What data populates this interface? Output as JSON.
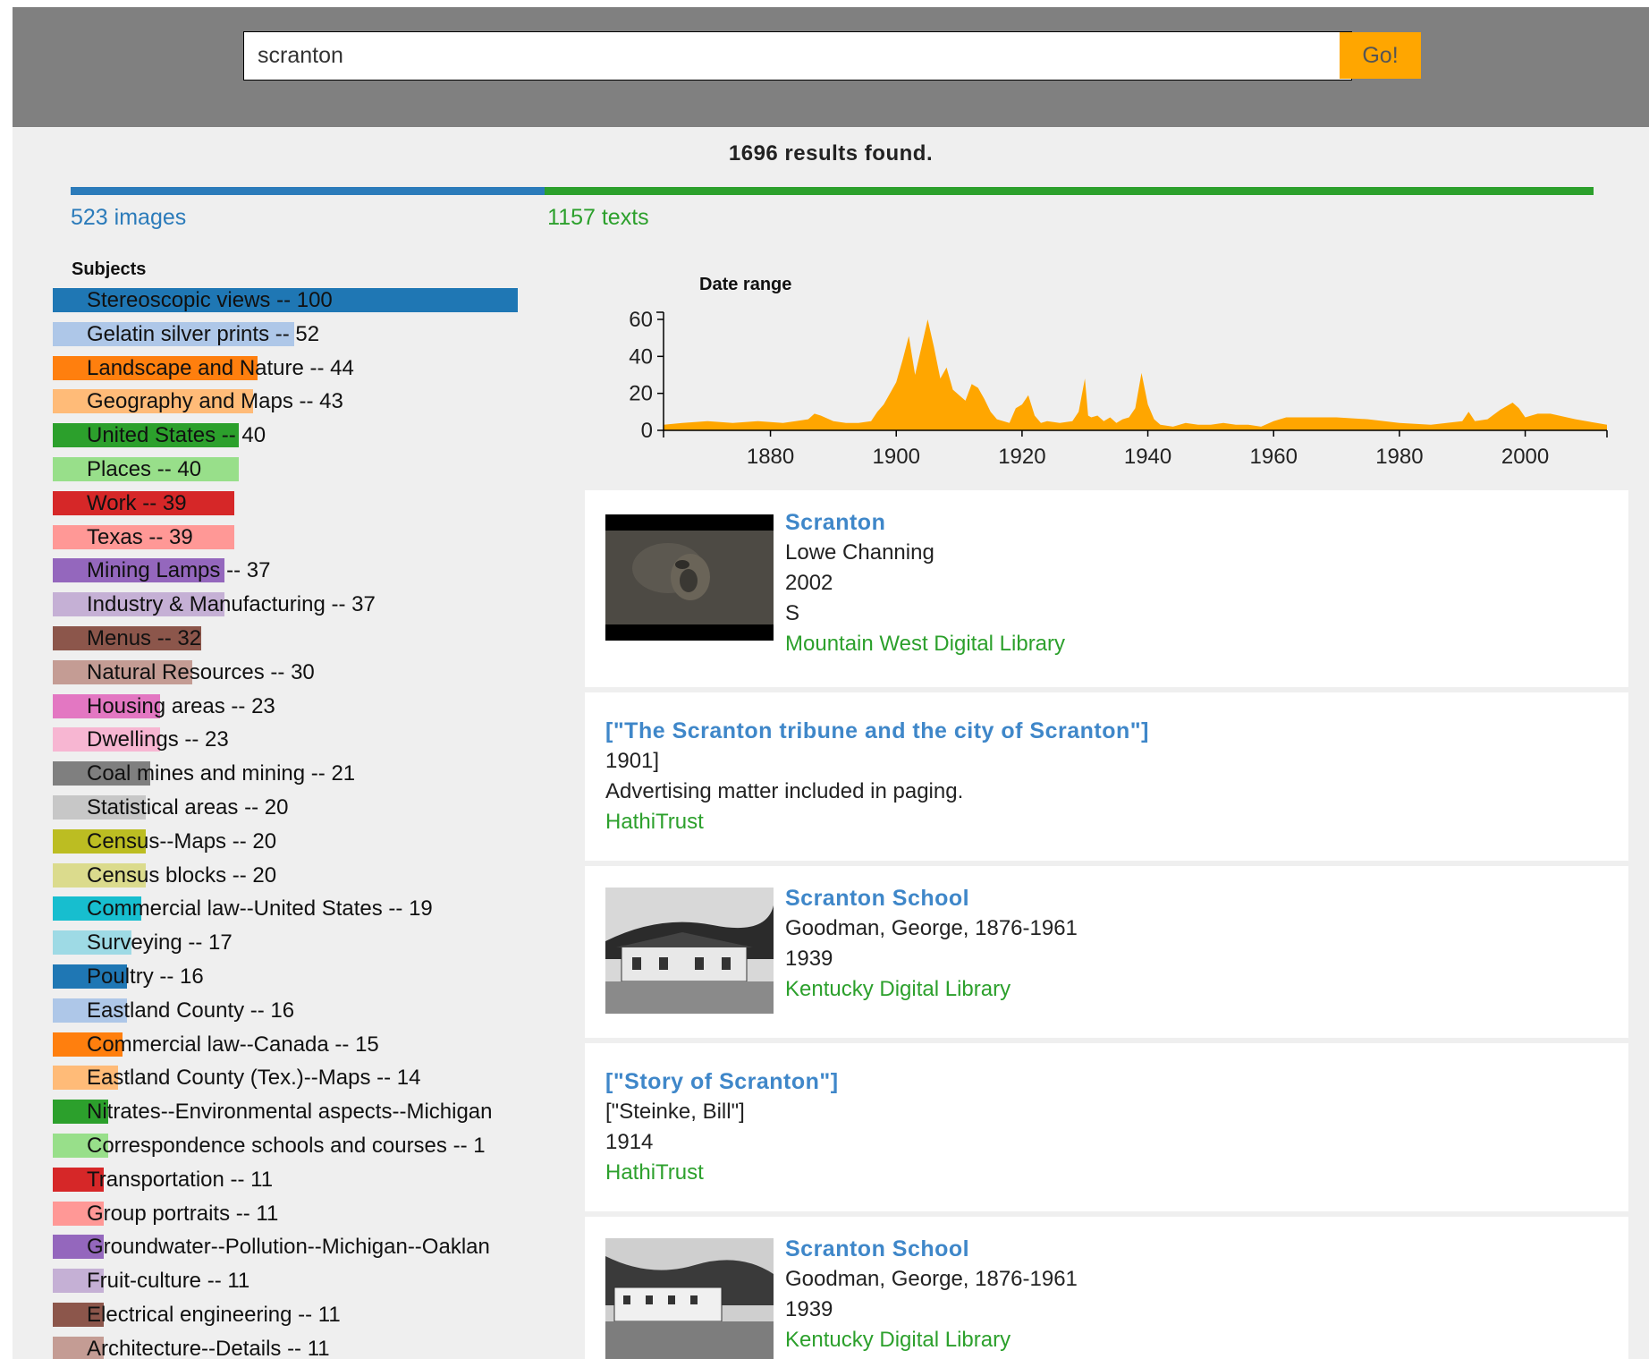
{
  "search": {
    "value": "scranton",
    "button_label": "Go!"
  },
  "summary": {
    "results_text": "1696 results found.",
    "images": {
      "count": 523,
      "label": "523 images",
      "color": "#2b7bba"
    },
    "texts": {
      "count": 1157,
      "label": "1157 texts",
      "color": "#2ca02c"
    }
  },
  "subjects": {
    "heading": "Subjects",
    "items": [
      {
        "label": "Stereoscopic views -- 100",
        "count": 100,
        "color": "#1f77b4"
      },
      {
        "label": "Gelatin silver prints -- 52",
        "count": 52,
        "color": "#aec7e8"
      },
      {
        "label": "Landscape and Nature -- 44",
        "count": 44,
        "color": "#ff7f0e"
      },
      {
        "label": "Geography and Maps -- 43",
        "count": 43,
        "color": "#ffbb78"
      },
      {
        "label": "United States -- 40",
        "count": 40,
        "color": "#2ca02c"
      },
      {
        "label": "Places -- 40",
        "count": 40,
        "color": "#98df8a"
      },
      {
        "label": "Work -- 39",
        "count": 39,
        "color": "#d62728"
      },
      {
        "label": "Texas -- 39",
        "count": 39,
        "color": "#ff9896"
      },
      {
        "label": "Mining Lamps -- 37",
        "count": 37,
        "color": "#9467bd"
      },
      {
        "label": "Industry & Manufacturing -- 37",
        "count": 37,
        "color": "#c5b0d5"
      },
      {
        "label": "Menus -- 32",
        "count": 32,
        "color": "#8c564b"
      },
      {
        "label": "Natural Resources -- 30",
        "count": 30,
        "color": "#c49c94"
      },
      {
        "label": "Housing areas -- 23",
        "count": 23,
        "color": "#e377c2"
      },
      {
        "label": "Dwellings -- 23",
        "count": 23,
        "color": "#f7b6d2"
      },
      {
        "label": "Coal mines and mining -- 21",
        "count": 21,
        "color": "#7f7f7f"
      },
      {
        "label": "Statistical areas -- 20",
        "count": 20,
        "color": "#c7c7c7"
      },
      {
        "label": "Census--Maps -- 20",
        "count": 20,
        "color": "#bcbd22"
      },
      {
        "label": "Census blocks -- 20",
        "count": 20,
        "color": "#dbdb8d"
      },
      {
        "label": "Commercial law--United States -- 19",
        "count": 19,
        "color": "#17becf"
      },
      {
        "label": "Surveying -- 17",
        "count": 17,
        "color": "#9edae5"
      },
      {
        "label": "Poultry -- 16",
        "count": 16,
        "color": "#1f77b4"
      },
      {
        "label": "Eastland County -- 16",
        "count": 16,
        "color": "#aec7e8"
      },
      {
        "label": "Commercial law--Canada -- 15",
        "count": 15,
        "color": "#ff7f0e"
      },
      {
        "label": "Eastland County (Tex.)--Maps -- 14",
        "count": 14,
        "color": "#ffbb78"
      },
      {
        "label": "Nitrates--Environmental aspects--Michigan",
        "count": 12,
        "color": "#2ca02c"
      },
      {
        "label": "Correspondence schools and courses -- 1",
        "count": 12,
        "color": "#98df8a"
      },
      {
        "label": "Transportation -- 11",
        "count": 11,
        "color": "#d62728"
      },
      {
        "label": "Group portraits -- 11",
        "count": 11,
        "color": "#ff9896"
      },
      {
        "label": "Groundwater--Pollution--Michigan--Oaklan",
        "count": 11,
        "color": "#9467bd"
      },
      {
        "label": "Fruit-culture -- 11",
        "count": 11,
        "color": "#c5b0d5"
      },
      {
        "label": "Electrical engineering -- 11",
        "count": 11,
        "color": "#8c564b"
      },
      {
        "label": "Architecture--Details -- 11",
        "count": 11,
        "color": "#c49c94"
      }
    ]
  },
  "chart_data": {
    "type": "area",
    "title": "Date range",
    "color": "#ffa600",
    "xlim": [
      1863,
      2013
    ],
    "ylim": [
      0,
      60
    ],
    "xticks": [
      1880,
      1900,
      1920,
      1940,
      1960,
      1980,
      2000
    ],
    "yticks": [
      0,
      20,
      40,
      60
    ],
    "x": [
      1863,
      1866,
      1870,
      1874,
      1878,
      1882,
      1884,
      1886,
      1887,
      1888,
      1890,
      1892,
      1894,
      1896,
      1897,
      1898,
      1899,
      1900,
      1901,
      1902,
      1903,
      1904,
      1905,
      1906,
      1907,
      1908,
      1909,
      1910,
      1911,
      1912,
      1913,
      1914,
      1915,
      1916,
      1918,
      1919,
      1920,
      1921,
      1922,
      1923,
      1924,
      1926,
      1928,
      1929,
      1930,
      1930.5,
      1931,
      1932,
      1933,
      1934,
      1935,
      1936,
      1937,
      1938,
      1939,
      1940,
      1941,
      1942,
      1944,
      1946,
      1948,
      1950,
      1952,
      1954,
      1956,
      1958,
      1960,
      1962,
      1966,
      1970,
      1975,
      1980,
      1985,
      1990,
      1991,
      1992,
      1994,
      1996,
      1998,
      1999,
      2000,
      2002,
      2004,
      2008,
      2013
    ],
    "y": [
      3,
      4,
      5,
      4,
      5,
      4,
      5,
      6,
      9,
      8,
      5,
      4,
      4,
      5,
      10,
      14,
      20,
      26,
      38,
      51,
      30,
      45,
      60,
      45,
      28,
      34,
      22,
      19,
      16,
      25,
      23,
      17,
      10,
      6,
      4,
      12,
      14,
      19,
      8,
      4,
      5,
      4,
      5,
      10,
      28,
      8,
      7,
      8,
      5,
      7,
      4,
      6,
      7,
      12,
      31,
      14,
      6,
      3,
      2,
      4,
      3,
      3,
      4,
      3,
      3,
      2,
      5,
      7,
      7,
      7,
      6,
      4,
      3,
      5,
      10,
      5,
      6,
      11,
      15,
      12,
      7,
      9,
      9,
      6,
      3
    ]
  },
  "results": [
    {
      "title": "Scranton",
      "lines": [
        "Lowe Channing",
        "2002",
        "S"
      ],
      "source": "Mountain West Digital Library",
      "thumb": "dark-photo"
    },
    {
      "title": "[\"The Scranton tribune and the city of Scranton\"]",
      "lines": [
        "1901]",
        "Advertising matter included in paging."
      ],
      "source": "HathiTrust",
      "thumb": null
    },
    {
      "title": "Scranton School",
      "lines": [
        "Goodman, George, 1876-1961",
        "1939"
      ],
      "source": "Kentucky Digital Library",
      "thumb": "school-photo"
    },
    {
      "title": "[\"Story of Scranton\"]",
      "lines": [
        "[\"Steinke, Bill\"]",
        "1914"
      ],
      "source": "HathiTrust",
      "thumb": null
    },
    {
      "title": "Scranton School",
      "lines": [
        "Goodman, George, 1876-1961",
        "1939"
      ],
      "source": "Kentucky Digital Library",
      "thumb": "school-photo-2"
    }
  ]
}
